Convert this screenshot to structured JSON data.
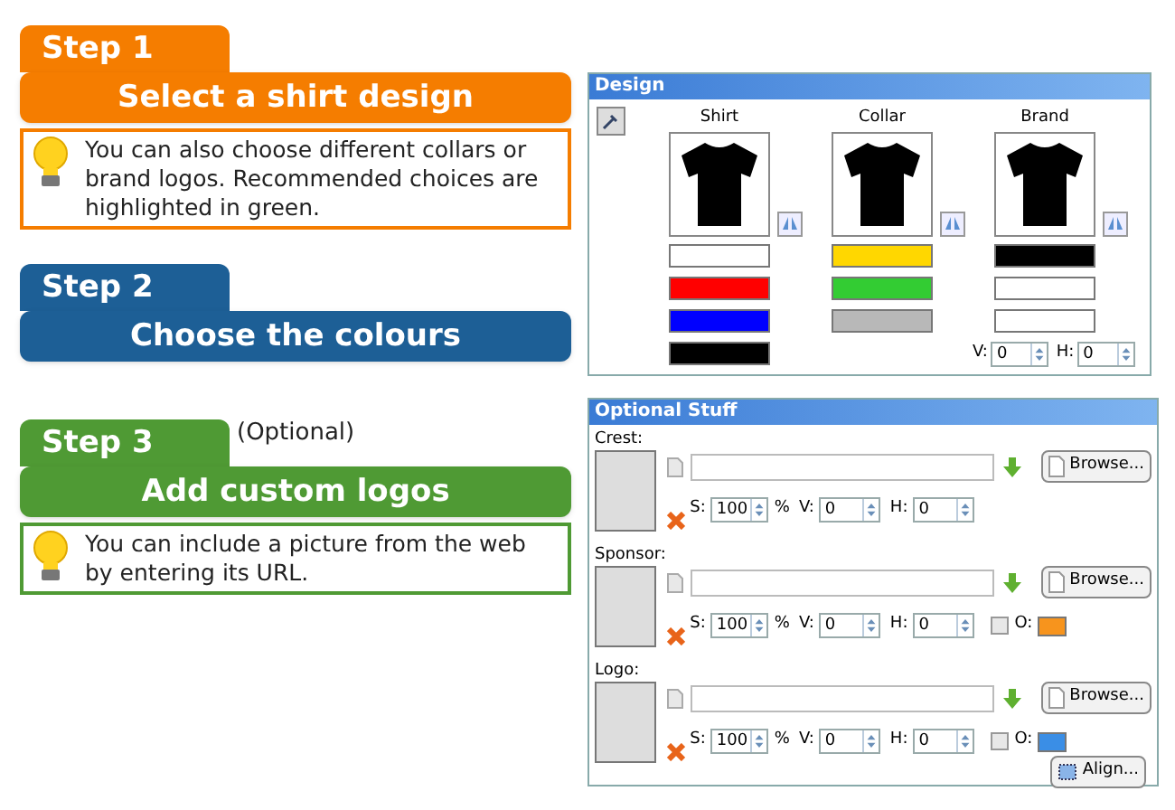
{
  "steps": [
    {
      "label": "Step 1",
      "color": "#f57d00",
      "title": "Select a shirt design",
      "tip": "You can also choose different collars or brand logos. Recommended choices are highlighted in green."
    },
    {
      "label": "Step 2",
      "color": "#1d5f96",
      "title": "Choose the colours"
    },
    {
      "label": "Step 3",
      "color": "#4f9a34",
      "note": "(Optional)",
      "title": "Add custom logos",
      "tip": "You can include a picture from the web by entering its URL."
    }
  ],
  "design": {
    "title": "Design",
    "columns": [
      {
        "label": "Shirt",
        "swatches": [
          {
            "color": "#ffffff"
          },
          {
            "color": "#ff0000"
          },
          {
            "color": "#0000ff"
          },
          {
            "color": "#000000"
          }
        ]
      },
      {
        "label": "Collar",
        "swatches": [
          {
            "color": "#ffd700"
          },
          {
            "color": "#33cc33"
          },
          {
            "color": "#b8b8b8"
          }
        ]
      },
      {
        "label": "Brand",
        "swatches": [
          {
            "color": "#000000"
          },
          {
            "color": "#ffffff"
          },
          {
            "color": "#ffffff"
          }
        ]
      }
    ],
    "v_label": "V:",
    "v_value": "0",
    "h_label": "H:",
    "h_value": "0"
  },
  "optional": {
    "title": "Optional Stuff",
    "rows": [
      {
        "label": "Crest:",
        "browse": "Browse...",
        "s_label": "S:",
        "s_value": "100",
        "percent": "%",
        "v_label": "V:",
        "v_value": "0",
        "h_label": "H:",
        "h_value": "0"
      },
      {
        "label": "Sponsor:",
        "browse": "Browse...",
        "s_label": "S:",
        "s_value": "100",
        "percent": "%",
        "v_label": "V:",
        "v_value": "0",
        "h_label": "H:",
        "h_value": "0",
        "outline": {
          "checked": false,
          "label": "O:",
          "color": "#f7941d"
        }
      },
      {
        "label": "Logo:",
        "browse": "Browse...",
        "s_label": "S:",
        "s_value": "100",
        "percent": "%",
        "v_label": "V:",
        "v_value": "0",
        "h_label": "H:",
        "h_value": "0",
        "outline": {
          "checked": false,
          "label": "O:",
          "color": "#3a8ee6"
        }
      }
    ],
    "align": "Align..."
  }
}
